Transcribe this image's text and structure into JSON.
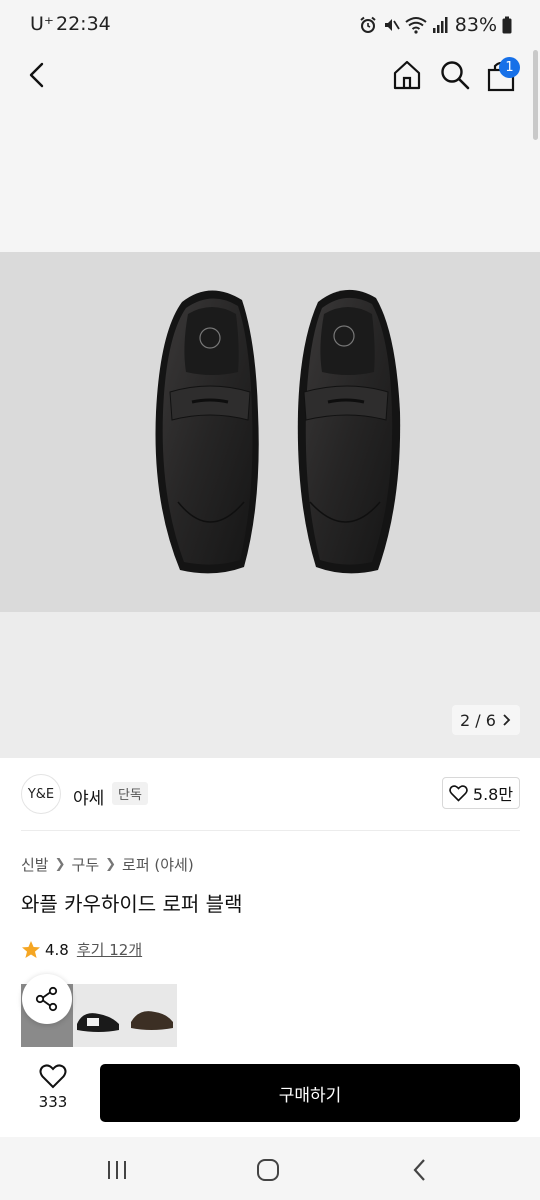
{
  "status_bar": {
    "carrier": "U⁺",
    "time": "22:34",
    "battery": "83%",
    "icons": [
      "alarm-icon",
      "mute-icon",
      "wifi-icon",
      "signal-icon",
      "battery-icon"
    ]
  },
  "header": {
    "cart_count": "1",
    "icons": [
      "back-icon",
      "home-icon",
      "search-icon",
      "shopping-bag-icon"
    ]
  },
  "gallery": {
    "counter": "2 / 6"
  },
  "brand": {
    "logo_text": "Y&E",
    "name": "야세",
    "tag": "단독",
    "likes": "5.8만"
  },
  "breadcrumb": [
    "신발",
    "구두",
    "로퍼 (야세)"
  ],
  "product": {
    "title": "와플 카우하이드 로퍼 블랙",
    "rating": "4.8",
    "review_link": "후기 12개"
  },
  "bottom_bar": {
    "wish_count": "333",
    "buy_label": "구매하기"
  },
  "colors": {
    "accent_badge": "#1670e8",
    "star": "#f5a623",
    "buy_button": "#000000"
  }
}
